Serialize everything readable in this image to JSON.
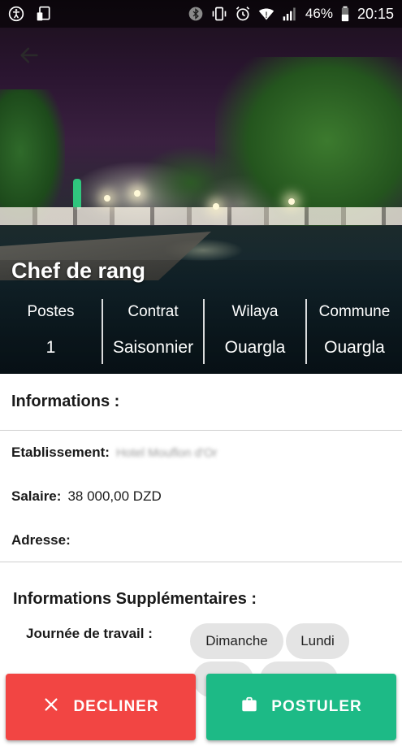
{
  "status_bar": {
    "icons_left": [
      "accessibility-icon",
      "screen-cast-icon"
    ],
    "icons_right": [
      "bluetooth-icon",
      "vibrate-icon",
      "alarm-icon",
      "wifi-icon",
      "signal-icon",
      "battery-icon"
    ],
    "battery": "46%",
    "time": "20:15"
  },
  "header": {
    "back_icon": "arrow-left-icon",
    "title": "Chef de rang",
    "stats": [
      {
        "label": "Postes",
        "value": "1"
      },
      {
        "label": "Contrat",
        "value": "Saisonnier"
      },
      {
        "label": "Wilaya",
        "value": "Ouargla"
      },
      {
        "label": "Commune",
        "value": "Ouargla"
      }
    ]
  },
  "informations": {
    "title": "Informations :",
    "etablissement_label": "Etablissement:",
    "etablissement_value": "Hotel Mouflon d'Or",
    "salaire_label": "Salaire:",
    "salaire_value": "38 000,00 DZD",
    "adresse_label": "Adresse:"
  },
  "supplementaires": {
    "title": "Informations Supplémentaires :",
    "workday_label": "Journée de travail :",
    "days": [
      "Dimanche",
      "Lundi",
      "",
      ""
    ]
  },
  "actions": {
    "decline_label": "DECLINER",
    "decline_icon": "close-icon",
    "apply_label": "POSTULER",
    "apply_icon": "briefcase-icon",
    "decline_color": "#f24543",
    "apply_color": "#1dba86"
  }
}
